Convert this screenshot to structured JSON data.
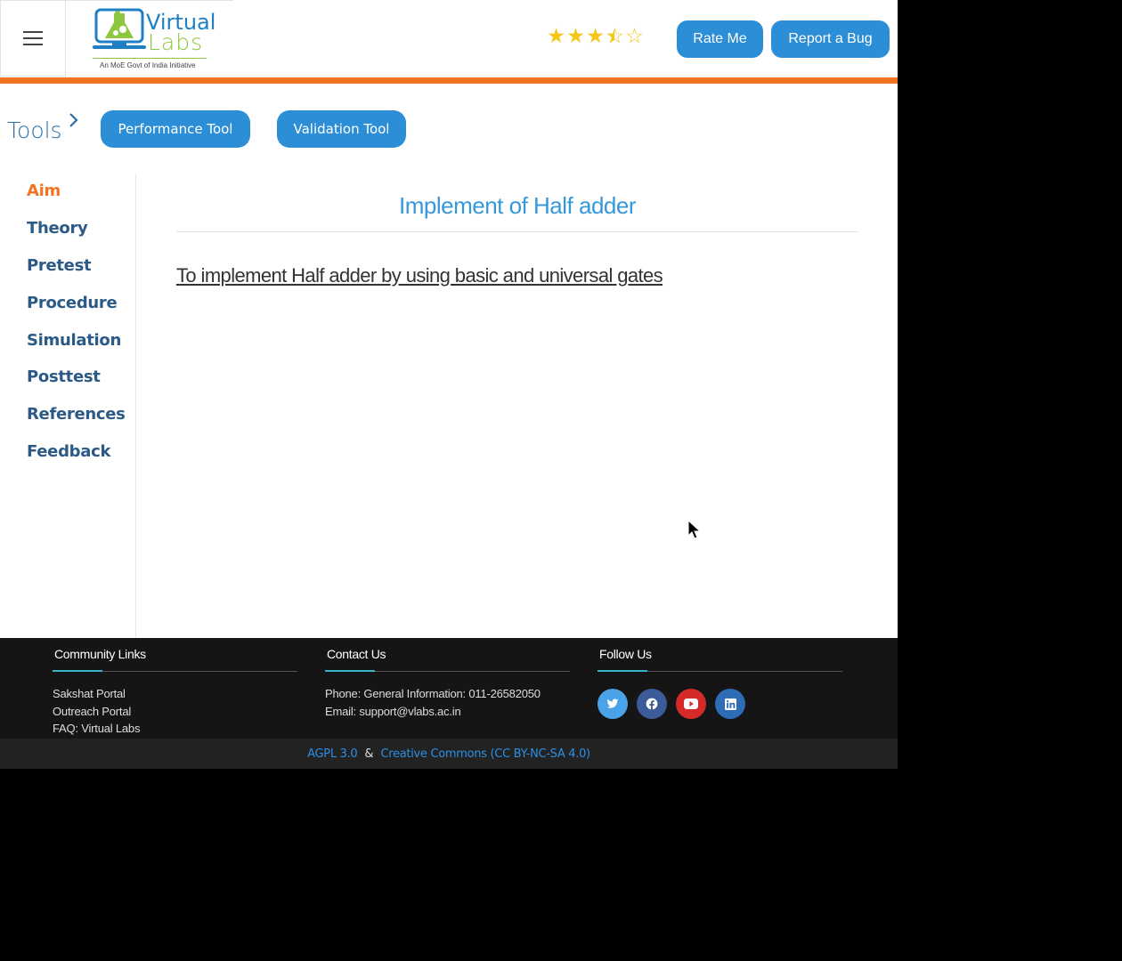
{
  "header": {
    "logo": {
      "title_line1": "Virtual",
      "title_line2": "Labs",
      "tagline": "An MoE Govt of India Initiative"
    },
    "rating": {
      "value": 3.5,
      "max": 5
    },
    "rate_button": "Rate Me",
    "bug_button": "Report a Bug",
    "accent_color": "#f27321"
  },
  "tools": {
    "label": "Tools",
    "buttons": [
      "Performance Tool",
      "Validation Tool"
    ]
  },
  "sidebar": {
    "active": "Aim",
    "items": [
      "Aim",
      "Theory",
      "Pretest",
      "Procedure",
      "Simulation",
      "Posttest",
      "References",
      "Feedback"
    ]
  },
  "main": {
    "title": "Implement of Half adder",
    "aim": "To implement Half adder by using basic and universal gates"
  },
  "footer": {
    "community": {
      "heading": "Community Links",
      "links": [
        "Sakshat Portal",
        "Outreach Portal",
        "FAQ: Virtual Labs"
      ]
    },
    "contact": {
      "heading": "Contact Us",
      "lines": [
        "Phone: General Information: 011-26582050",
        "Email: support@vlabs.ac.in"
      ]
    },
    "follow": {
      "heading": "Follow Us",
      "icons": [
        "twitter-icon",
        "facebook-icon",
        "youtube-icon",
        "linkedin-icon"
      ]
    },
    "license": {
      "link1": "AGPL 3.0",
      "separator": "&",
      "link2": "Creative Commons (CC BY-NC-SA 4.0)"
    }
  },
  "colors": {
    "primary_button": "#2c8ed6",
    "sidebar_text": "#2b5a87",
    "title_blue": "#3498db",
    "footer_bg": "#151515",
    "twitter": "#4aa3e8",
    "facebook": "#3b5b99",
    "youtube": "#d62a2a",
    "linkedin": "#2e6db5"
  }
}
